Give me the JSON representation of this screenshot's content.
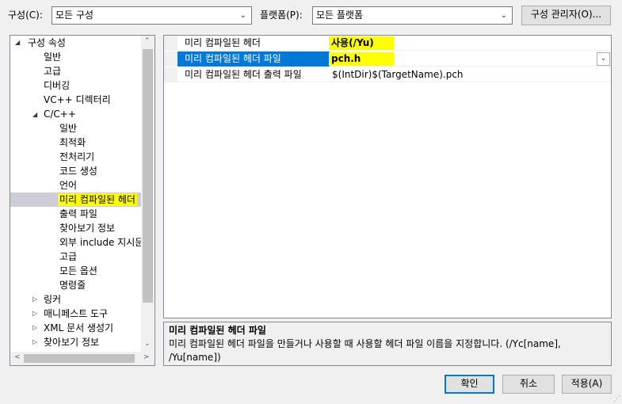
{
  "toolbar": {
    "config_label": "구성(C):",
    "config_value": "모든 구성",
    "platform_label": "플랫폼(P):",
    "platform_value": "모든 플랫폼",
    "config_manager_button": "구성 관리자(O)..."
  },
  "tree": {
    "root": "구성 속성",
    "items": [
      "일반",
      "고급",
      "디버깅",
      "VC++ 디렉터리"
    ],
    "cpp": {
      "label": "C/C++",
      "children": [
        "일반",
        "최적화",
        "전처리기",
        "코드 생성",
        "언어",
        "미리 컴파일된 헤더",
        "출력 파일",
        "찾아보기 정보",
        "외부 include 지시문",
        "고급",
        "모든 옵션",
        "명령줄"
      ],
      "selected_index": 5
    },
    "collapsed": [
      "링커",
      "매니페스트 도구",
      "XML 문서 생성기",
      "찾아보기 정보"
    ]
  },
  "grid": {
    "rows": [
      {
        "name": "미리 컴파일된 헤더",
        "value": "사용(/Yu)"
      },
      {
        "name": "미리 컴파일된 헤더 파일",
        "value": "pch.h"
      },
      {
        "name": "미리 컴파일된 헤더 출력 파일",
        "value": "$(IntDir)$(TargetName).pch"
      }
    ],
    "selected_row": 1
  },
  "description": {
    "title": "미리 컴파일된 헤더 파일",
    "text": "미리 컴파일된 헤더 파일을 만들거나 사용할 때 사용할 헤더 파일 이름을 지정합니다. (/Yc[name], /Yu[name])"
  },
  "buttons": {
    "ok": "확인",
    "cancel": "취소",
    "apply": "적용(A)"
  },
  "colors": {
    "highlight": "#ffff00",
    "selection": "#0078d7",
    "tree_selection": "#cdcdd7"
  }
}
